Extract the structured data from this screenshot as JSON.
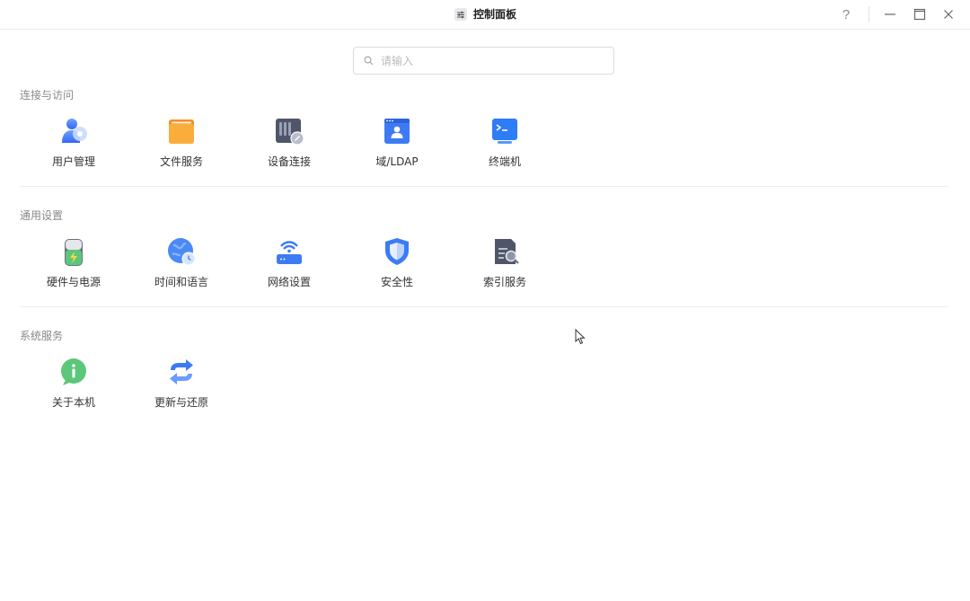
{
  "window": {
    "title": "控制面板",
    "help_label": "?"
  },
  "search": {
    "placeholder": "请输入",
    "value": ""
  },
  "sections": [
    {
      "title": "连接与访问",
      "items": [
        {
          "label": "用户管理",
          "icon": "users-icon"
        },
        {
          "label": "文件服务",
          "icon": "folder-icon"
        },
        {
          "label": "设备连接",
          "icon": "device-link-icon"
        },
        {
          "label": "域/LDAP",
          "icon": "ldap-icon"
        },
        {
          "label": "终端机",
          "icon": "terminal-icon"
        }
      ]
    },
    {
      "title": "通用设置",
      "items": [
        {
          "label": "硬件与电源",
          "icon": "battery-icon"
        },
        {
          "label": "时间和语言",
          "icon": "globe-clock-icon"
        },
        {
          "label": "网络设置",
          "icon": "router-icon"
        },
        {
          "label": "安全性",
          "icon": "shield-icon"
        },
        {
          "label": "索引服务",
          "icon": "index-search-icon"
        }
      ]
    },
    {
      "title": "系统服务",
      "items": [
        {
          "label": "关于本机",
          "icon": "info-icon"
        },
        {
          "label": "更新与还原",
          "icon": "update-icon"
        }
      ]
    }
  ],
  "colors": {
    "accent_blue": "#3d7bf5",
    "folder_orange": "#f9a22b",
    "green": "#5cc77a",
    "section_text": "#888888"
  }
}
